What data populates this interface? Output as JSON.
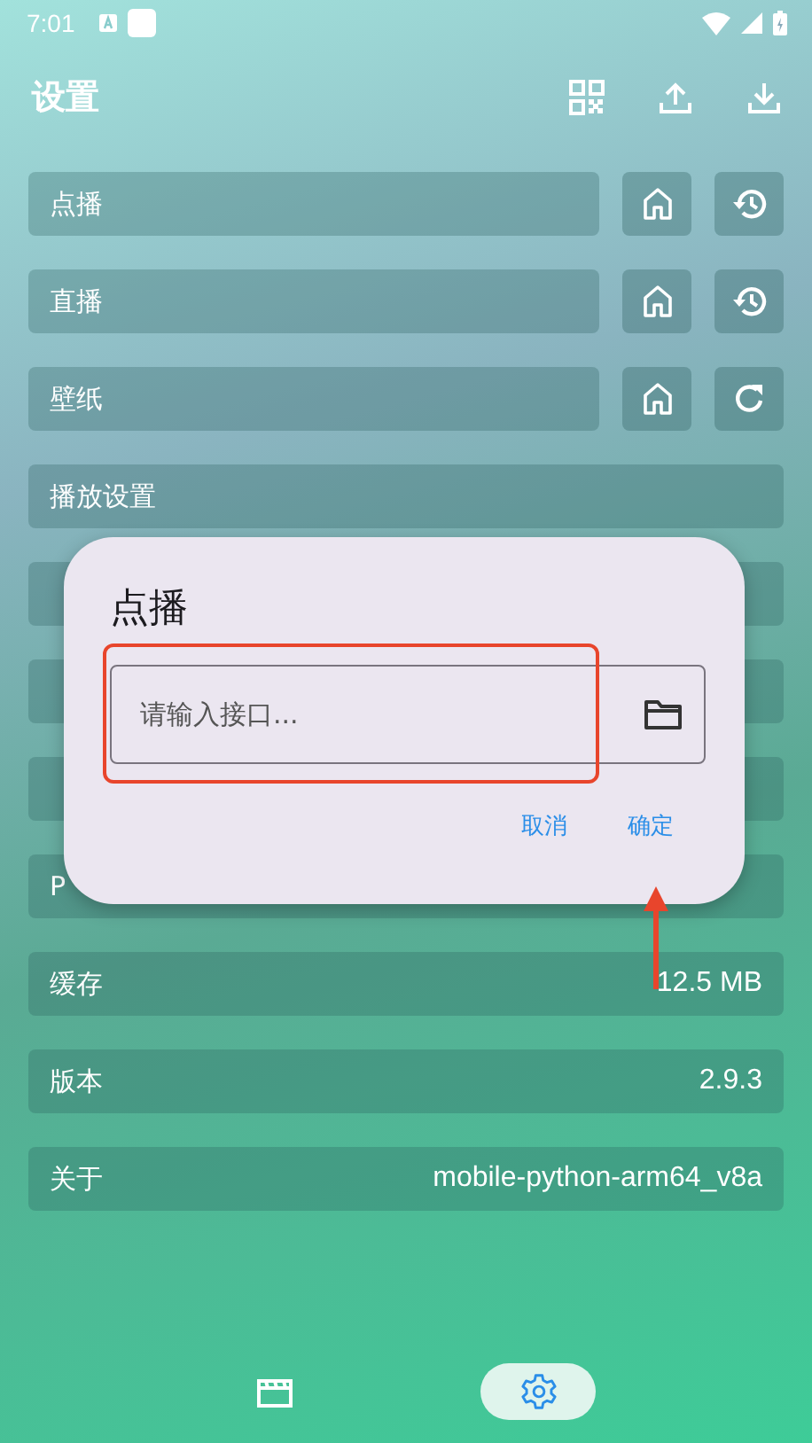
{
  "status_bar": {
    "time": "7:01"
  },
  "header": {
    "title": "设置"
  },
  "rows": [
    {
      "kind": "history",
      "label": "点播"
    },
    {
      "kind": "history",
      "label": "直播"
    },
    {
      "kind": "refresh",
      "label": "壁纸"
    },
    {
      "kind": "plain",
      "label": "播放设置"
    },
    {
      "kind": "plain"
    },
    {
      "kind": "plain"
    },
    {
      "kind": "plain"
    },
    {
      "kind": "plain",
      "label": "P"
    },
    {
      "kind": "plain",
      "label": "缓存",
      "value": "12.5 MB"
    },
    {
      "kind": "plain",
      "label": "版本",
      "value": "2.9.3"
    },
    {
      "kind": "plain",
      "label": "关于",
      "value": "mobile-python-arm64_v8a"
    }
  ],
  "dialog": {
    "title": "点播",
    "field": {
      "placeholder": "请输入接口..."
    },
    "buttons": [
      "取消",
      "确定"
    ]
  },
  "bottom_nav": [
    {
      "kind": "film",
      "selected": false
    },
    {
      "kind": "settings",
      "selected": true
    }
  ]
}
